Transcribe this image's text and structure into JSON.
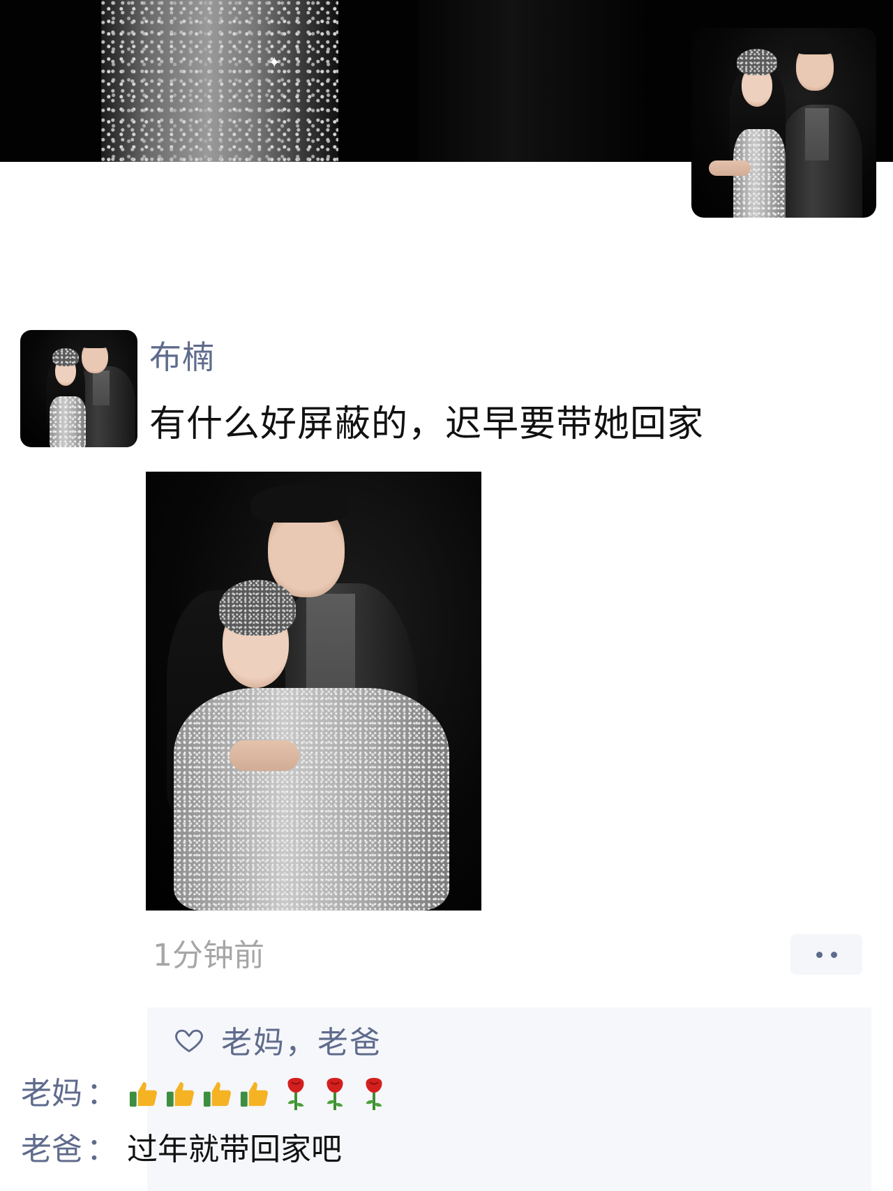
{
  "post": {
    "author": "布楠",
    "text": "有什么好屏蔽的，迟早要带她回家",
    "timestamp": "1分钟前"
  },
  "likes": {
    "icon": "heart-outline-icon",
    "names": "老妈，老爸"
  },
  "comments": [
    {
      "commenter": "老妈",
      "separator": "：",
      "emojis": [
        "thumbs-up",
        "thumbs-up",
        "thumbs-up",
        "thumbs-up",
        "rose",
        "rose",
        "rose"
      ]
    },
    {
      "commenter": "老爸",
      "separator": "：",
      "text": "过年就带回家吧"
    }
  ],
  "colors": {
    "name_link": "#5f6b8c",
    "timestamp": "#a6a6a6",
    "interaction_bg": "#f5f7fa"
  }
}
